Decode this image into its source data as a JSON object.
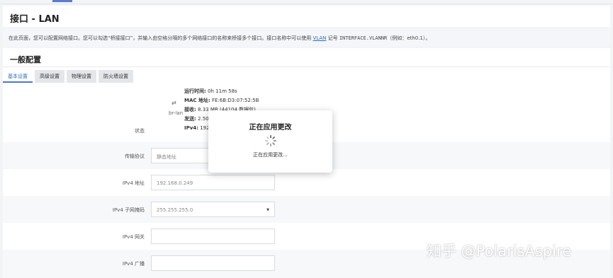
{
  "page": {
    "title": "接口 - LAN"
  },
  "description": {
    "prefix": "在此页面，您可以配置网络接口。您可以勾选“桥接接口”，并输入由空格分隔的多个网络接口的名称来桥接多个接口。接口名称中可以使用 ",
    "link": "VLAN",
    "middle": " 记号 ",
    "mono": "INTERFACE.VLANNR",
    "suffix": "（例如：eth0.1）。"
  },
  "section": {
    "title": "一般配置"
  },
  "tabs": [
    {
      "label": "基本设置",
      "active": true
    },
    {
      "label": "高级设置",
      "active": false
    },
    {
      "label": "物理设置",
      "active": false
    },
    {
      "label": "防火墙设置",
      "active": false
    }
  ],
  "status": {
    "label": "状态",
    "device": "br-lan",
    "lines": [
      {
        "key": "运行时间:",
        "value": "0h 11m 58s"
      },
      {
        "key": "MAC 地址:",
        "value": "FE:6B:D3:07:52:5B"
      },
      {
        "key": "接收:",
        "value": "8.33 MB (44104 数据包)"
      },
      {
        "key": "发送:",
        "value": "2.50"
      },
      {
        "key": "IPv4:",
        "value": "192.1"
      }
    ]
  },
  "form": {
    "protocol": {
      "label": "传输协议",
      "value": "静态地址"
    },
    "ipv4_address": {
      "label": "IPv4 地址",
      "value": "192.168.0.249"
    },
    "ipv4_netmask": {
      "label": "IPv4 子网掩码",
      "value": "255.255.255.0"
    },
    "ipv4_gateway": {
      "label": "IPv4 网关",
      "value": ""
    },
    "ipv4_broadcast": {
      "label": "IPv4 广播",
      "value": ""
    }
  },
  "overlay": {
    "title": "正在应用更改",
    "message": "正在应用更改..."
  },
  "watermark": "知乎 @PolarisAspire",
  "colors": {
    "accent": "#4a78d2",
    "link": "#2a6cc4"
  }
}
